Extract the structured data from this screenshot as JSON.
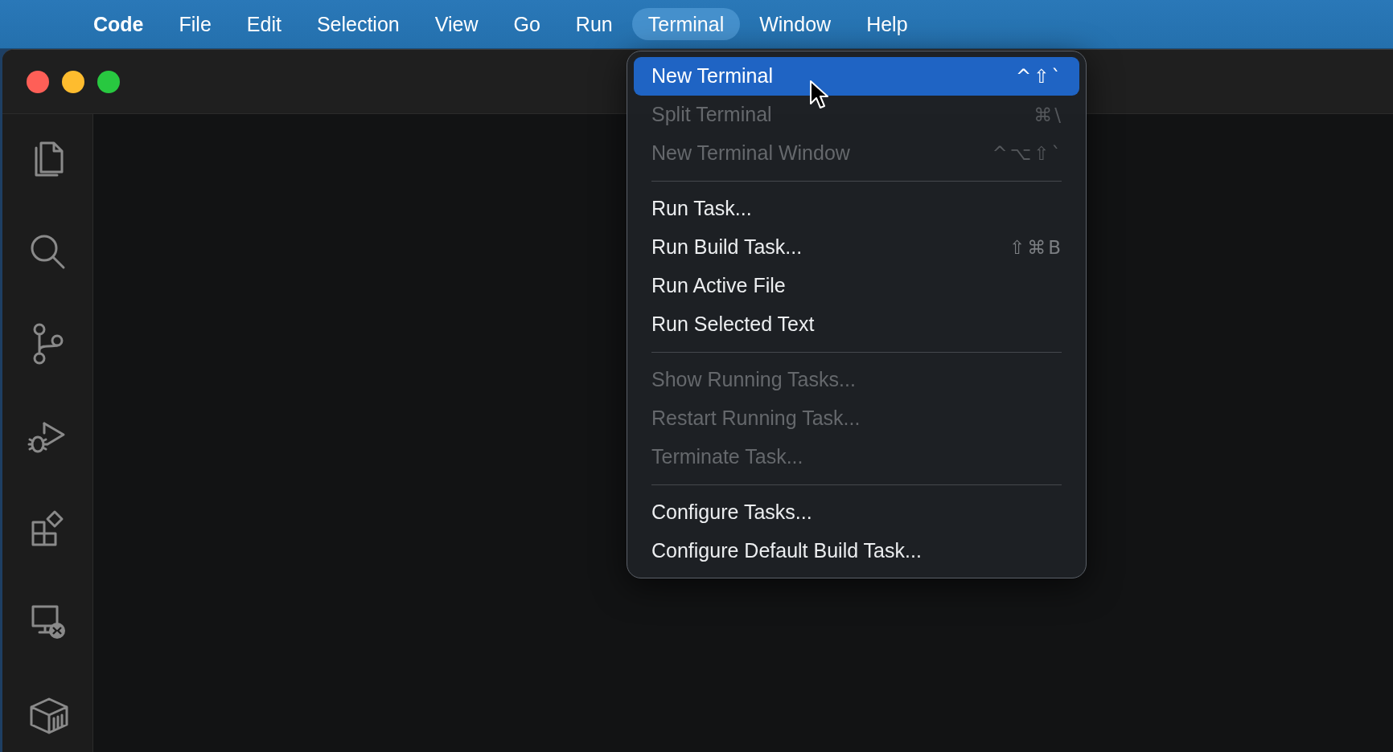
{
  "menu_bar": {
    "items": [
      {
        "label": "Code",
        "kind": "app",
        "selected": false
      },
      {
        "label": "File",
        "kind": "menu",
        "selected": false
      },
      {
        "label": "Edit",
        "kind": "menu",
        "selected": false
      },
      {
        "label": "Selection",
        "kind": "menu",
        "selected": false
      },
      {
        "label": "View",
        "kind": "menu",
        "selected": false
      },
      {
        "label": "Go",
        "kind": "menu",
        "selected": false
      },
      {
        "label": "Run",
        "kind": "menu",
        "selected": false
      },
      {
        "label": "Terminal",
        "kind": "menu",
        "selected": true
      },
      {
        "label": "Window",
        "kind": "menu",
        "selected": false
      },
      {
        "label": "Help",
        "kind": "menu",
        "selected": false
      }
    ]
  },
  "terminal_menu": {
    "items": [
      {
        "kind": "item",
        "label": "New Terminal",
        "shortcut": "^⇧`",
        "disabled": false,
        "selected": true
      },
      {
        "kind": "item",
        "label": "Split Terminal",
        "shortcut": "⌘\\",
        "disabled": true,
        "selected": false
      },
      {
        "kind": "item",
        "label": "New Terminal Window",
        "shortcut": "^⌥⇧`",
        "disabled": true,
        "selected": false
      },
      {
        "kind": "separator"
      },
      {
        "kind": "item",
        "label": "Run Task...",
        "disabled": false,
        "selected": false
      },
      {
        "kind": "item",
        "label": "Run Build Task...",
        "shortcut": "⇧⌘B",
        "disabled": false,
        "selected": false
      },
      {
        "kind": "item",
        "label": "Run Active File",
        "disabled": false,
        "selected": false
      },
      {
        "kind": "item",
        "label": "Run Selected Text",
        "disabled": false,
        "selected": false
      },
      {
        "kind": "separator"
      },
      {
        "kind": "item",
        "label": "Show Running Tasks...",
        "disabled": true,
        "selected": false
      },
      {
        "kind": "item",
        "label": "Restart Running Task...",
        "disabled": true,
        "selected": false
      },
      {
        "kind": "item",
        "label": "Terminate Task...",
        "disabled": true,
        "selected": false
      },
      {
        "kind": "separator"
      },
      {
        "kind": "item",
        "label": "Configure Tasks...",
        "disabled": false,
        "selected": false
      },
      {
        "kind": "item",
        "label": "Configure Default Build Task...",
        "disabled": false,
        "selected": false
      }
    ]
  }
}
